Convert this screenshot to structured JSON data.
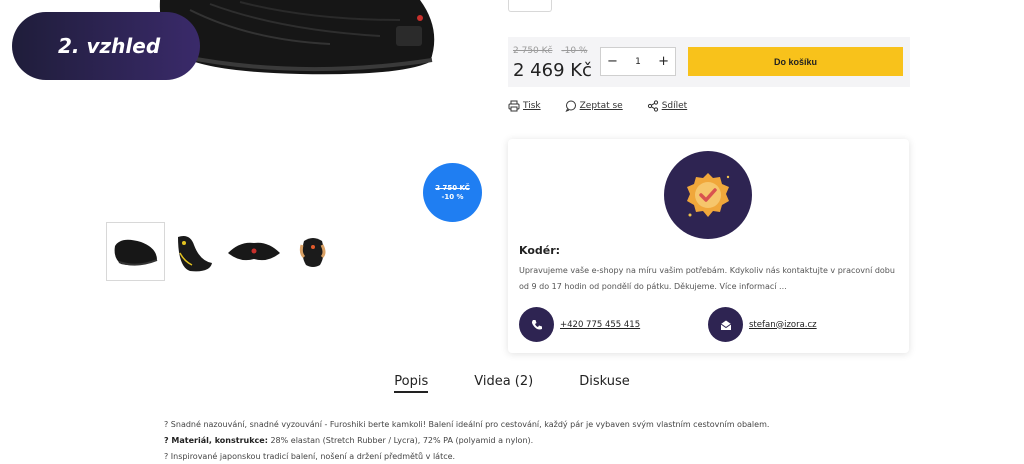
{
  "badge": {
    "label": "2. vzhled"
  },
  "price": {
    "old_price": "2 750 Kč",
    "discount": "-10 %",
    "current": "2 469 Kč",
    "quantity": "1",
    "cart_label": "Do košíku",
    "accent": "#f8c21b"
  },
  "actions": {
    "print": "Tisk",
    "ask": "Zeptat se",
    "share": "Sdílet"
  },
  "discount_badge": {
    "old": "2 750 KČ",
    "pct": "-10 %",
    "color": "#1f7ef2"
  },
  "contact": {
    "title": "Kodér:",
    "text": "Upravujeme vaše e-shopy na míru vašim potřebám. Kdykoliv nás kontaktujte v pracovní dobu od 9 do 17 hodin od pondělí do pátku. Děkujeme. Více informací ...",
    "phone": "+420 775 455 415",
    "email": "stefan@izora.cz"
  },
  "tabs": [
    {
      "label": "Popis"
    },
    {
      "label": "Videa (2)"
    },
    {
      "label": "Diskuse"
    }
  ],
  "description": {
    "line1": "? Snadné nazouvání, snadné vyzouvání - Furoshiki berte kamkoli! Balení ideální pro cestování, každý pár je vybaven svým vlastním cestovním obalem.",
    "line2_label": "? Materiál, konstrukce:",
    "line2_text": " 28% elastan (Stretch Rubber / Lycra), 72% PA (polyamid a nylon).",
    "line3": "? Inspirované japonskou tradicí balení, nošení a držení předmětů v látce."
  }
}
